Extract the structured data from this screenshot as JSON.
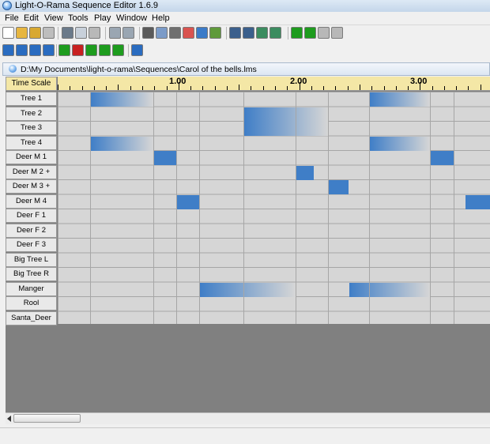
{
  "window": {
    "title": "Light-O-Rama Sequence Editor 1.6.9"
  },
  "menu": [
    "File",
    "Edit",
    "View",
    "Tools",
    "Play",
    "Window",
    "Help"
  ],
  "toolbar1": [
    {
      "name": "new-file-icon",
      "color": "#ffffff"
    },
    {
      "name": "open-folder-icon",
      "color": "#e7b640"
    },
    {
      "name": "save-icon",
      "color": "#d8a830"
    },
    {
      "name": "disabled-icon",
      "color": "#bdbdbd"
    },
    {
      "name": "cut-icon",
      "color": "#6b7a8a"
    },
    {
      "name": "copy-icon",
      "color": "#c8d0da"
    },
    {
      "name": "paste-icon",
      "color": "#b8b8b8"
    },
    {
      "name": "undo-icon",
      "color": "#9aa6b2"
    },
    {
      "name": "redo-icon",
      "color": "#9aa6b2"
    },
    {
      "name": "channel-properties-icon",
      "color": "#5a5a5a"
    },
    {
      "name": "eraser-icon",
      "color": "#7b9bc8"
    },
    {
      "name": "grid-view-icon",
      "color": "#6f6f6f"
    },
    {
      "name": "color-icon",
      "color": "#d9534f"
    },
    {
      "name": "clock-icon",
      "color": "#3b7bc8"
    },
    {
      "name": "settings-icon",
      "color": "#5f9a3a"
    },
    {
      "name": "zoom-in-icon",
      "color": "#3b5f8c"
    },
    {
      "name": "zoom-out-icon",
      "color": "#3b5f8c"
    },
    {
      "name": "zoom-fit-icon",
      "color": "#3b8c5f"
    },
    {
      "name": "zoom-marker-icon",
      "color": "#3b8c5f"
    },
    {
      "name": "play-icon",
      "color": "#1e9c1e"
    },
    {
      "name": "play-from-icon",
      "color": "#1e9c1e"
    },
    {
      "name": "pause-icon",
      "color": "#b8b8b8"
    },
    {
      "name": "stop-icon",
      "color": "#b8b8b8"
    }
  ],
  "toolbar2": [
    {
      "name": "ramp-up-icon",
      "color": "#2a6cc0"
    },
    {
      "name": "shimmer-icon",
      "color": "#2a6cc0"
    },
    {
      "name": "twinkle-icon",
      "color": "#2a6cc0"
    },
    {
      "name": "toggle-icon",
      "color": "#2a6cc0"
    },
    {
      "name": "on-icon",
      "color": "#1e9c1e"
    },
    {
      "name": "off-icon",
      "color": "#c82020"
    },
    {
      "name": "intensity-icon",
      "color": "#1e9c1e"
    },
    {
      "name": "fade-up-icon",
      "color": "#1e9c1e"
    },
    {
      "name": "fade-down-icon",
      "color": "#1e9c1e"
    },
    {
      "name": "help-icon",
      "color": "#2a6cc0"
    }
  ],
  "document": {
    "path": "D:\\My Documents\\light-o-rama\\Sequences\\Carol of the bells.lms"
  },
  "timeline": {
    "scale_label": "Time Scale",
    "labels": [
      {
        "text": "1.00",
        "t": 1.0
      },
      {
        "text": "2.00",
        "t": 2.0
      },
      {
        "text": "3.00",
        "t": 3.0
      }
    ],
    "boundaries": [
      0,
      0.27,
      0.79,
      0.98,
      1.17,
      1.54,
      1.97,
      2.24,
      2.58,
      3.08,
      3.28,
      3.58
    ],
    "end": 3.58
  },
  "channels": [
    {
      "name": "Tree 1",
      "events": [
        {
          "from": 0.27,
          "to": 0.79,
          "effect": "fade"
        },
        {
          "from": 2.58,
          "to": 3.08,
          "effect": "fade"
        }
      ]
    },
    {
      "name": "Tree 2",
      "events": [
        {
          "from": 1.54,
          "to": 2.24,
          "effect": "fade"
        }
      ]
    },
    {
      "name": "Tree 3",
      "events": [
        {
          "from": 1.54,
          "to": 2.24,
          "effect": "fade"
        }
      ]
    },
    {
      "name": "Tree 4",
      "events": [
        {
          "from": 0.27,
          "to": 0.79,
          "effect": "fade"
        },
        {
          "from": 2.58,
          "to": 3.08,
          "effect": "fade"
        }
      ]
    },
    {
      "name": "Deer M 1",
      "events": [
        {
          "from": 0.79,
          "to": 0.98,
          "effect": "on"
        },
        {
          "from": 3.08,
          "to": 3.28,
          "effect": "on"
        }
      ]
    },
    {
      "name": "Deer M 2  +",
      "events": [
        {
          "from": 1.97,
          "to": 2.12,
          "effect": "on"
        }
      ]
    },
    {
      "name": "Deer M 3 +",
      "events": [
        {
          "from": 2.24,
          "to": 2.41,
          "effect": "on"
        }
      ]
    },
    {
      "name": "Deer M 4",
      "events": [
        {
          "from": 0.98,
          "to": 1.17,
          "effect": "on"
        },
        {
          "from": 3.37,
          "to": 3.58,
          "effect": "on"
        }
      ]
    },
    {
      "name": "Deer F 1",
      "events": []
    },
    {
      "name": "Deer F 2",
      "events": []
    },
    {
      "name": "Deer F 3",
      "events": []
    },
    {
      "name": "Big Tree L",
      "events": []
    },
    {
      "name": "Big Tree R",
      "events": []
    },
    {
      "name": "Manger",
      "events": [
        {
          "from": 1.17,
          "to": 1.97,
          "effect": "fade"
        },
        {
          "from": 2.41,
          "to": 3.08,
          "effect": "fade"
        }
      ]
    },
    {
      "name": "Rool",
      "events": []
    },
    {
      "name": "Santa_Deer",
      "events": []
    }
  ],
  "colors": {
    "event_on": "#3f7ec7",
    "event_fade_start": "#3f7ec7",
    "event_fade_end": "#d6d6d6",
    "grid": "#d6d6d6",
    "ruler": "#f4e7a6"
  }
}
